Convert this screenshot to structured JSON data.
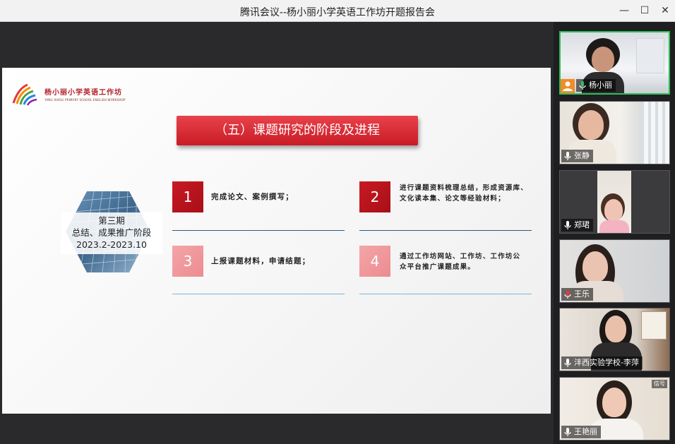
{
  "window": {
    "title": "腾讯会议--杨小丽小学英语工作坊开题报告会",
    "minimize_glyph": "—",
    "maximize_glyph": "☐",
    "close_glyph": "✕"
  },
  "slide": {
    "logo_cn": "杨小丽小学英语工作坊",
    "logo_en": "YANG XIAOLI PRIMARY SCHOOL ENGLISH WORKSHOP",
    "banner_title": "（五）课题研究的阶段及进程",
    "phase": {
      "line1": "第三期",
      "line2": "总结、成果推广阶段",
      "line3": "2023.2-2023.10"
    },
    "items": [
      {
        "num": "1",
        "text": "完成论文、案例撰写；"
      },
      {
        "num": "2",
        "text": "进行课题资料梳理总结，形成资源库、文化读本集、论文等经验材料；"
      },
      {
        "num": "3",
        "text": "上报课题材料，申请结题；"
      },
      {
        "num": "4",
        "text": "通过工作坊网站、工作坊、工作坊公众平台推广课题成果。"
      }
    ]
  },
  "participants": [
    {
      "name": "杨小丽",
      "host": true,
      "active": true
    },
    {
      "name": "张静"
    },
    {
      "name": "郑珺"
    },
    {
      "name": "王乐"
    },
    {
      "name": "沣西实验学校-李萍"
    },
    {
      "name": "王艳丽",
      "signal": "信号"
    }
  ],
  "colors": {
    "banner_red": "#d42a33",
    "num_dark": "#c81a22",
    "num_light": "#f29a9d",
    "active_border": "#2fbf5a",
    "host_orange": "#f28c28"
  }
}
